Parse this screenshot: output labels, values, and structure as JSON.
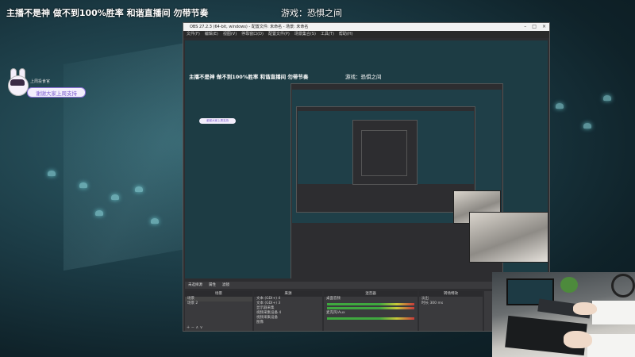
{
  "overlay": {
    "headline": "主播不是神 做不到100%胜率  和谐直播间  勿带节奏",
    "game_label": "游戏：恐惧之间",
    "subtitle_tag": "上周投食官",
    "thanks_pill": "谢谢大家上周支持"
  },
  "obs": {
    "title": "OBS 27.2.3 (64-bit, windows) - 配置文件: 未命名 - 场景: 未命名",
    "menu": [
      "文件(F)",
      "编辑(E)",
      "视图(V)",
      "停靠窗口(D)",
      "配置文件(P)",
      "场景集合(S)",
      "工具(T)",
      "帮助(H)"
    ],
    "preview_headline": "主播不是神 做不到100%胜率  和谐直播间  勿带节奏",
    "preview_game": "游戏：恐惧之间",
    "preview_pill": "谢谢大家上周支持",
    "dock_label": "未选择源",
    "dock_buttons": [
      "属性",
      "滤镜"
    ],
    "scenes": {
      "title": "场景",
      "items": [
        "场景",
        "场景 2"
      ]
    },
    "sources": {
      "title": "来源",
      "items": [
        "文本 (GDI+) 4",
        "文本 (GDI+) 3",
        "显示器采集",
        "视频采集设备 4",
        "视频采集设备",
        "图像"
      ]
    },
    "mixer": {
      "title": "混音器",
      "channels": [
        "桌面音频",
        "麦克风/Aux"
      ]
    },
    "transitions": {
      "title": "转场特效",
      "type": "淡出",
      "duration_label": "时长",
      "duration": "300 ms"
    }
  },
  "colors": {
    "accent": "#7a58cf",
    "obs_bg": "#2d2d30",
    "scene_bg": "#1d3c44"
  }
}
